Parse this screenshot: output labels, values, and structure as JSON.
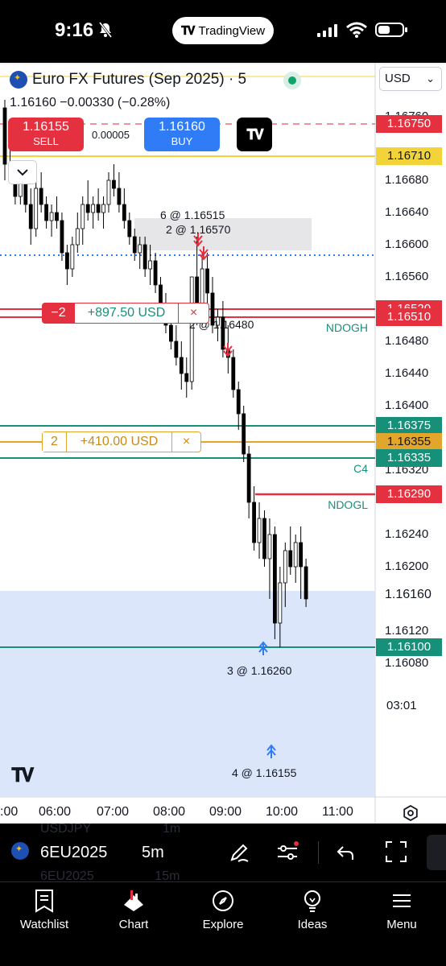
{
  "status_bar": {
    "time": "9:16",
    "app_pill": "TradingView"
  },
  "header": {
    "title": "Euro FX Futures (Sep 2025) · 5",
    "last_price": "1.16160",
    "change": "−0.00330 (−0.28%)",
    "sell_price": "1.16155",
    "sell_label": "SELL",
    "buy_price": "1.16160",
    "buy_label": "BUY",
    "spread": "0.00005",
    "currency": "USD"
  },
  "axis": {
    "price_labels": [
      "1.16760",
      "1.16680",
      "1.16640",
      "1.16600",
      "1.16560",
      "1.16480",
      "1.16440",
      "1.16400",
      "1.16320",
      "1.16240",
      "1.16200",
      "1.16120",
      "1.16080"
    ],
    "last_price_label": "1.16160",
    "countdown": "03:01",
    "time_labels": [
      ":00",
      "06:00",
      "07:00",
      "08:00",
      "09:00",
      "10:00",
      "11:00"
    ]
  },
  "levels": [
    {
      "price": "1.16750",
      "color": "#e5303f",
      "text_color": "#ffffff",
      "style": "dashed"
    },
    {
      "price": "1.16710",
      "color": "#f2d33a",
      "text_color": "#131722",
      "style": "solid"
    },
    {
      "price": "1.16520",
      "color": "#e5303f",
      "text_color": "#ffffff",
      "style": "solid"
    },
    {
      "price": "1.16510",
      "color": "#e5303f",
      "text_color": "#ffffff",
      "style": "solid",
      "label": "NDOGH"
    },
    {
      "price": "1.16375",
      "color": "#17907a",
      "text_color": "#ffffff",
      "style": "solid"
    },
    {
      "price": "1.16355",
      "color": "#e3a62c",
      "text_color": "#131722",
      "style": "solid"
    },
    {
      "price": "1.16335",
      "color": "#17907a",
      "text_color": "#ffffff",
      "style": "solid",
      "label": "C4"
    },
    {
      "price": "1.16290",
      "color": "#e5303f",
      "text_color": "#ffffff",
      "style": "solid",
      "label": "NDOGL"
    },
    {
      "price": "1.16100",
      "color": "#17907a",
      "text_color": "#ffffff",
      "style": "solid"
    }
  ],
  "positions": [
    {
      "qty": "−2",
      "pnl": "+897.50 USD",
      "close": "×",
      "color": "#e5303f",
      "pnl_color": "#17907a"
    },
    {
      "qty": "2",
      "pnl": "+410.00 USD",
      "close": "×",
      "color": "#e3a62c",
      "pnl_color": "#c8891a"
    }
  ],
  "fills": [
    {
      "text": "6 @ 1.16515"
    },
    {
      "text": "2 @ 1.16570"
    },
    {
      "text": "2 @ 1.16480"
    },
    {
      "text": "3 @ 1.16260"
    },
    {
      "text": "4 @ 1.16155"
    }
  ],
  "bottom_bar": {
    "symbol": "6EU2025",
    "interval": "5m",
    "ghost_top": "USDJPY",
    "ghost_top_int": "1m",
    "ghost_bottom": "6EU2025",
    "ghost_bottom_int": "15m"
  },
  "tabs": [
    {
      "label": "Watchlist",
      "icon": "bookmark-icon"
    },
    {
      "label": "Chart",
      "icon": "chart-icon"
    },
    {
      "label": "Explore",
      "icon": "compass-icon"
    },
    {
      "label": "Ideas",
      "icon": "lightbulb-icon"
    },
    {
      "label": "Menu",
      "icon": "hamburger-icon"
    }
  ],
  "colors": {
    "bull": "#ffffff",
    "bear": "#000000",
    "sell": "#e5303f",
    "buy": "#2f7cf6",
    "teal": "#17907a",
    "dotted_line": "#2f7cf6"
  },
  "candles": [
    [
      1.1677,
      1.1678,
      1.1668,
      1.167
    ],
    [
      1.167,
      1.1672,
      1.1668,
      1.1669
    ],
    [
      1.1669,
      1.167,
      1.1665,
      1.1666
    ],
    [
      1.1666,
      1.167,
      1.1665,
      1.1669
    ],
    [
      1.1669,
      1.167,
      1.1664,
      1.1665
    ],
    [
      1.1665,
      1.1667,
      1.166,
      1.1662
    ],
    [
      1.1662,
      1.1668,
      1.1661,
      1.1667
    ],
    [
      1.1667,
      1.1669,
      1.1664,
      1.1665
    ],
    [
      1.1665,
      1.1666,
      1.1662,
      1.1663
    ],
    [
      1.1663,
      1.1665,
      1.1661,
      1.1664
    ],
    [
      1.1664,
      1.1666,
      1.1662,
      1.1663
    ],
    [
      1.1663,
      1.1664,
      1.1658,
      1.1659
    ],
    [
      1.1659,
      1.166,
      1.1655,
      1.1657
    ],
    [
      1.1657,
      1.1661,
      1.1656,
      1.166
    ],
    [
      1.166,
      1.1664,
      1.1659,
      1.1662
    ],
    [
      1.1662,
      1.1666,
      1.166,
      1.1665
    ],
    [
      1.1665,
      1.1668,
      1.1663,
      1.1664
    ],
    [
      1.1664,
      1.1666,
      1.1662,
      1.1665
    ],
    [
      1.1665,
      1.1667,
      1.1663,
      1.1664
    ],
    [
      1.1664,
      1.1666,
      1.1662,
      1.1665
    ],
    [
      1.1665,
      1.1669,
      1.1664,
      1.1668
    ],
    [
      1.1668,
      1.167,
      1.1666,
      1.1667
    ],
    [
      1.1667,
      1.1669,
      1.1664,
      1.1665
    ],
    [
      1.1665,
      1.1667,
      1.1662,
      1.1663
    ],
    [
      1.1663,
      1.1664,
      1.166,
      1.1661
    ],
    [
      1.1661,
      1.1662,
      1.1658,
      1.1659
    ],
    [
      1.1659,
      1.1661,
      1.1657,
      1.166
    ],
    [
      1.166,
      1.1661,
      1.1656,
      1.1657
    ],
    [
      1.1657,
      1.166,
      1.1655,
      1.1658
    ],
    [
      1.1658,
      1.1659,
      1.1654,
      1.1655
    ],
    [
      1.1655,
      1.1656,
      1.1651,
      1.1652
    ],
    [
      1.1652,
      1.1654,
      1.1649,
      1.165
    ],
    [
      1.165,
      1.1652,
      1.1647,
      1.1648
    ],
    [
      1.1648,
      1.165,
      1.1645,
      1.1646
    ],
    [
      1.1646,
      1.1648,
      1.1642,
      1.1644
    ],
    [
      1.1644,
      1.1646,
      1.1641,
      1.1643
    ],
    [
      1.1643,
      1.1656,
      1.1642,
      1.1656
    ],
    [
      1.1656,
      1.1661,
      1.165,
      1.1652
    ],
    [
      1.1652,
      1.1659,
      1.165,
      1.1657
    ],
    [
      1.1657,
      1.1659,
      1.1652,
      1.1654
    ],
    [
      1.1654,
      1.1656,
      1.1649,
      1.165
    ],
    [
      1.165,
      1.1652,
      1.1648,
      1.1651
    ],
    [
      1.1651,
      1.1653,
      1.1646,
      1.1647
    ],
    [
      1.1647,
      1.165,
      1.1644,
      1.1646
    ],
    [
      1.1646,
      1.1647,
      1.1641,
      1.1642
    ],
    [
      1.1642,
      1.1643,
      1.1637,
      1.1639
    ],
    [
      1.1639,
      1.164,
      1.1633,
      1.1634
    ],
    [
      1.1634,
      1.1635,
      1.1626,
      1.1628
    ],
    [
      1.1628,
      1.163,
      1.1622,
      1.1623
    ],
    [
      1.1623,
      1.1628,
      1.1621,
      1.1626
    ],
    [
      1.1626,
      1.1627,
      1.162,
      1.1621
    ],
    [
      1.1621,
      1.1626,
      1.1616,
      1.1624
    ],
    [
      1.1624,
      1.1625,
      1.1611,
      1.1613
    ],
    [
      1.1613,
      1.162,
      1.161,
      1.1618
    ],
    [
      1.1618,
      1.1623,
      1.1615,
      1.1622
    ],
    [
      1.1622,
      1.1625,
      1.1619,
      1.162
    ],
    [
      1.162,
      1.1624,
      1.1618,
      1.1623
    ],
    [
      1.1623,
      1.1625,
      1.1616,
      1.162
    ],
    [
      1.162,
      1.1621,
      1.1615,
      1.1616
    ]
  ]
}
